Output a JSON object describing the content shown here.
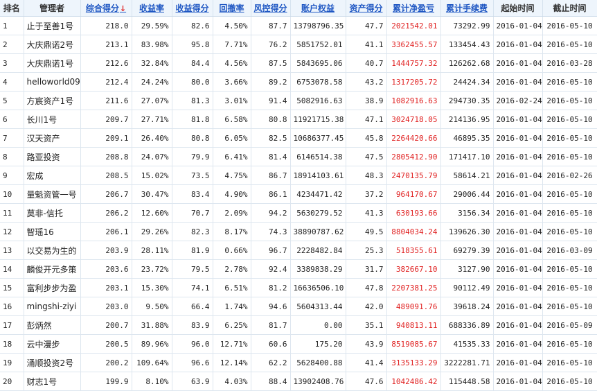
{
  "colors": {
    "link": "#1f57c3",
    "profit": "#e02020",
    "header_bg": "#eef5fc"
  },
  "headers": {
    "rank": "排名",
    "manager": "管理者",
    "total_score": "综合得分",
    "sort_arrow": "↓",
    "return_rate": "收益率",
    "return_score": "收益得分",
    "drawdown": "回撤率",
    "risk_score": "风控得分",
    "equity": "账户权益",
    "asset_score": "资产得分",
    "cum_pnl": "累计净盈亏",
    "cum_fee": "累计手续费",
    "start_date": "起始时间",
    "end_date": "截止时间"
  },
  "rows": [
    {
      "rank": "1",
      "name": "止于至善1号",
      "score": "218.0",
      "ret": "29.59%",
      "ret_score": "82.6",
      "dd": "4.50%",
      "risk": "87.7",
      "equity": "13798796.35",
      "asset": "47.7",
      "pnl": "2021542.01",
      "fee": "73292.99",
      "start": "2016-01-04",
      "end": "2016-05-10"
    },
    {
      "rank": "2",
      "name": "大庆鼎诺2号",
      "score": "213.1",
      "ret": "83.98%",
      "ret_score": "95.8",
      "dd": "7.71%",
      "risk": "76.2",
      "equity": "5851752.01",
      "asset": "41.1",
      "pnl": "3362455.57",
      "fee": "133454.43",
      "start": "2016-01-04",
      "end": "2016-05-10"
    },
    {
      "rank": "3",
      "name": "大庆鼎诺1号",
      "score": "212.6",
      "ret": "32.84%",
      "ret_score": "84.4",
      "dd": "4.56%",
      "risk": "87.5",
      "equity": "5843695.06",
      "asset": "40.7",
      "pnl": "1444757.32",
      "fee": "126262.68",
      "start": "2016-01-04",
      "end": "2016-03-28"
    },
    {
      "rank": "4",
      "name": "helloworld09",
      "score": "212.4",
      "ret": "24.24%",
      "ret_score": "80.0",
      "dd": "3.66%",
      "risk": "89.2",
      "equity": "6753078.58",
      "asset": "43.2",
      "pnl": "1317205.72",
      "fee": "24424.34",
      "start": "2016-01-04",
      "end": "2016-05-10"
    },
    {
      "rank": "5",
      "name": "方宸资产1号",
      "score": "211.6",
      "ret": "27.07%",
      "ret_score": "81.3",
      "dd": "3.01%",
      "risk": "91.4",
      "equity": "5082916.63",
      "asset": "38.9",
      "pnl": "1082916.63",
      "fee": "294730.35",
      "start": "2016-02-24",
      "end": "2016-05-10"
    },
    {
      "rank": "6",
      "name": "长川1号",
      "score": "209.7",
      "ret": "27.71%",
      "ret_score": "81.8",
      "dd": "6.58%",
      "risk": "80.8",
      "equity": "11921715.38",
      "asset": "47.1",
      "pnl": "3024718.05",
      "fee": "214136.95",
      "start": "2016-01-04",
      "end": "2016-05-10"
    },
    {
      "rank": "7",
      "name": "汉天资产",
      "score": "209.1",
      "ret": "26.40%",
      "ret_score": "80.8",
      "dd": "6.05%",
      "risk": "82.5",
      "equity": "10686377.45",
      "asset": "45.8",
      "pnl": "2264420.66",
      "fee": "46895.35",
      "start": "2016-01-04",
      "end": "2016-05-10"
    },
    {
      "rank": "8",
      "name": "路亚投资",
      "score": "208.8",
      "ret": "24.07%",
      "ret_score": "79.9",
      "dd": "6.41%",
      "risk": "81.4",
      "equity": "6146514.38",
      "asset": "47.5",
      "pnl": "2805412.90",
      "fee": "171417.10",
      "start": "2016-01-04",
      "end": "2016-05-10"
    },
    {
      "rank": "9",
      "name": "宏成",
      "score": "208.5",
      "ret": "15.02%",
      "ret_score": "73.5",
      "dd": "4.75%",
      "risk": "86.7",
      "equity": "18914103.61",
      "asset": "48.3",
      "pnl": "2470135.79",
      "fee": "58614.21",
      "start": "2016-01-04",
      "end": "2016-02-26"
    },
    {
      "rank": "10",
      "name": "量魁资管一号",
      "score": "206.7",
      "ret": "30.47%",
      "ret_score": "83.4",
      "dd": "4.90%",
      "risk": "86.1",
      "equity": "4234471.42",
      "asset": "37.2",
      "pnl": "964170.67",
      "fee": "29006.44",
      "start": "2016-01-04",
      "end": "2016-05-10"
    },
    {
      "rank": "11",
      "name": "莫非-信托",
      "score": "206.2",
      "ret": "12.60%",
      "ret_score": "70.7",
      "dd": "2.09%",
      "risk": "94.2",
      "equity": "5630279.52",
      "asset": "41.3",
      "pnl": "630193.66",
      "fee": "3156.34",
      "start": "2016-01-04",
      "end": "2016-05-10"
    },
    {
      "rank": "12",
      "name": "智瑶16",
      "score": "206.1",
      "ret": "29.26%",
      "ret_score": "82.3",
      "dd": "8.17%",
      "risk": "74.3",
      "equity": "38890787.62",
      "asset": "49.5",
      "pnl": "8804034.24",
      "fee": "139626.30",
      "start": "2016-01-04",
      "end": "2016-05-10"
    },
    {
      "rank": "13",
      "name": "以交易为生的",
      "score": "203.9",
      "ret": "28.11%",
      "ret_score": "81.9",
      "dd": "0.66%",
      "risk": "96.7",
      "equity": "2228482.84",
      "asset": "25.3",
      "pnl": "518355.61",
      "fee": "69279.39",
      "start": "2016-01-04",
      "end": "2016-03-09"
    },
    {
      "rank": "14",
      "name": "麟俊开元多策",
      "score": "203.6",
      "ret": "23.72%",
      "ret_score": "79.5",
      "dd": "2.78%",
      "risk": "92.4",
      "equity": "3389838.29",
      "asset": "31.7",
      "pnl": "382667.10",
      "fee": "3127.90",
      "start": "2016-01-04",
      "end": "2016-05-10"
    },
    {
      "rank": "15",
      "name": "富利步步为盈",
      "score": "203.1",
      "ret": "15.30%",
      "ret_score": "74.1",
      "dd": "6.51%",
      "risk": "81.2",
      "equity": "16636506.10",
      "asset": "47.8",
      "pnl": "2207381.25",
      "fee": "90112.49",
      "start": "2016-01-04",
      "end": "2016-05-10"
    },
    {
      "rank": "16",
      "name": "mingshi-ziyi",
      "score": "203.0",
      "ret": "9.50%",
      "ret_score": "66.4",
      "dd": "1.74%",
      "risk": "94.6",
      "equity": "5604313.44",
      "asset": "42.0",
      "pnl": "489091.76",
      "fee": "39618.24",
      "start": "2016-01-04",
      "end": "2016-05-10"
    },
    {
      "rank": "17",
      "name": "彭炳然",
      "score": "200.7",
      "ret": "31.88%",
      "ret_score": "83.9",
      "dd": "6.25%",
      "risk": "81.7",
      "equity": "0.00",
      "asset": "35.1",
      "pnl": "940813.11",
      "fee": "688336.89",
      "start": "2016-01-04",
      "end": "2016-05-09"
    },
    {
      "rank": "18",
      "name": "云中漫步",
      "score": "200.5",
      "ret": "89.96%",
      "ret_score": "96.0",
      "dd": "12.71%",
      "risk": "60.6",
      "equity": "175.20",
      "asset": "43.9",
      "pnl": "8519085.67",
      "fee": "41535.33",
      "start": "2016-01-04",
      "end": "2016-05-10"
    },
    {
      "rank": "19",
      "name": "涌顺投资2号",
      "score": "200.2",
      "ret": "109.64%",
      "ret_score": "96.6",
      "dd": "12.14%",
      "risk": "62.2",
      "equity": "5628400.88",
      "asset": "41.4",
      "pnl": "3135133.29",
      "fee": "3222281.71",
      "start": "2016-01-04",
      "end": "2016-05-10"
    },
    {
      "rank": "20",
      "name": "财志1号",
      "score": "199.9",
      "ret": "8.10%",
      "ret_score": "63.9",
      "dd": "4.03%",
      "risk": "88.4",
      "equity": "13902408.76",
      "asset": "47.6",
      "pnl": "1042486.42",
      "fee": "115448.58",
      "start": "2016-01-04",
      "end": "2016-05-10"
    }
  ]
}
